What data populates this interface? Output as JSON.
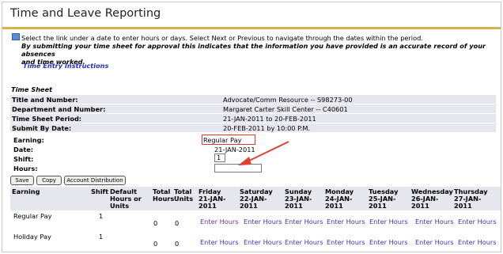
{
  "page": {
    "title": "Time and Leave Reporting",
    "info_line1": "Select the link under a date to enter hours or days. Select Next or Previous to navigate through the dates within the period.",
    "info_line2": "By submitting your time sheet for approval this indicates that the information you have provided is an accurate record of your absences",
    "info_line3": "and time worked.",
    "instructions_link": "Time Entry Instructions"
  },
  "timesheet": {
    "section_title": "Time Sheet",
    "rows": [
      {
        "label": "Title and Number:",
        "value": "Advocate/Comm Resource -- S98273-00"
      },
      {
        "label": "Department and Number:",
        "value": "Margaret Carter Skill Center -- C40601"
      },
      {
        "label": "Time Sheet Period:",
        "value": "21-JAN-2011 to 20-FEB-2011"
      },
      {
        "label": "Submit By Date:",
        "value": "20-FEB-2011 by 10:00 P.M."
      }
    ]
  },
  "form": {
    "earning_label": "Earning:",
    "earning_value": "Regular Pay",
    "date_label": "Date:",
    "date_value": "21-JAN-2011",
    "shift_label": "Shift:",
    "shift_value": "1",
    "hours_label": "Hours:",
    "hours_value": "",
    "highlight_color": "#d83a2a"
  },
  "buttons": {
    "save": "Save",
    "copy": "Copy",
    "account_distribution": "Account Distribution"
  },
  "grid": {
    "columns": [
      {
        "l1": "Earning",
        "l2": "",
        "l3": ""
      },
      {
        "l1": "Shift",
        "l2": "",
        "l3": ""
      },
      {
        "l1": "Default",
        "l2": "Hours or",
        "l3": "Units"
      },
      {
        "l1": "Total",
        "l2": "Hours",
        "l3": ""
      },
      {
        "l1": "Total",
        "l2": "Units",
        "l3": ""
      },
      {
        "l1": "Friday",
        "l2": "21-JAN-",
        "l3": "2011"
      },
      {
        "l1": "Saturday",
        "l2": "22-JAN-",
        "l3": "2011"
      },
      {
        "l1": "Sunday",
        "l2": "23-JAN-",
        "l3": "2011"
      },
      {
        "l1": "Monday",
        "l2": "24-JAN-",
        "l3": "2011"
      },
      {
        "l1": "Tuesday",
        "l2": "25-JAN-",
        "l3": "2011"
      },
      {
        "l1": "Wednesday",
        "l2": "26-JAN-",
        "l3": "2011"
      },
      {
        "l1": "Thursday",
        "l2": "27-JAN-",
        "l3": "2011"
      }
    ],
    "rows": [
      {
        "earning": "Regular Pay",
        "shift": "1",
        "total_hours": "0",
        "total_units": "0",
        "days": [
          "Enter Hours",
          "Enter Hours",
          "Enter Hours",
          "Enter Hours",
          "Enter Hours",
          "Enter Hours",
          "Enter Hours"
        ]
      },
      {
        "earning": "Holiday Pay",
        "shift": "1",
        "total_hours": "0",
        "total_units": "0",
        "days": [
          "Enter Hours",
          "Enter Hours",
          "Enter Hours",
          "Enter Hours",
          "Enter Hours",
          "Enter Hours",
          "Enter Hours"
        ]
      }
    ]
  }
}
